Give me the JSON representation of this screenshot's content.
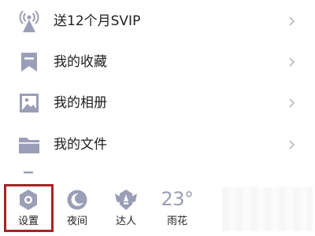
{
  "menu": {
    "items": [
      {
        "label": "送12个月SVIP",
        "icon": "signal-tower-icon"
      },
      {
        "label": "我的收藏",
        "icon": "bookmark-icon"
      },
      {
        "label": "我的相册",
        "icon": "image-icon"
      },
      {
        "label": "我的文件",
        "icon": "folder-icon"
      }
    ]
  },
  "bottom": {
    "settings": {
      "label": "设置",
      "icon": "settings-icon"
    },
    "night": {
      "label": "夜间",
      "icon": "moon-icon"
    },
    "expert": {
      "label": "达人",
      "icon": "expert-badge-icon"
    },
    "weather": {
      "temperature": "23°",
      "label": "雨花"
    }
  },
  "colors": {
    "icon": "#9a9eb6",
    "highlight": "#a82222",
    "chevron": "#b9b9b9"
  }
}
